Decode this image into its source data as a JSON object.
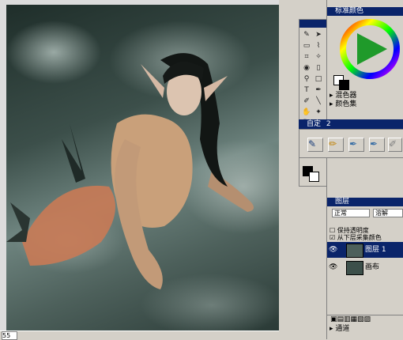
{
  "color_panel": {
    "title": "标准颜色",
    "mixer_label": "混色器",
    "colorset_label": "颜色集"
  },
  "brush_panel": {
    "title": "自定",
    "count": "2"
  },
  "layers_panel": {
    "title": "图层",
    "blend_mode": "正常",
    "composite": "溶解",
    "preserve_transparency": "保持透明度",
    "pick_up_underlying": "从下层采集颜色",
    "layers": [
      {
        "name": "图层 1",
        "selected": true
      },
      {
        "name": "画布",
        "selected": false
      }
    ]
  },
  "channels_panel": {
    "title": "通道"
  },
  "status": {
    "zoom": "55"
  },
  "colors": {
    "title_bar": "#0a246a",
    "dock_bg": "#d4d0c8",
    "selected_layer": "#0a246a"
  },
  "icons": [
    "eye-icon",
    "brush-icon",
    "pen-icon",
    "color-wheel-icon"
  ]
}
